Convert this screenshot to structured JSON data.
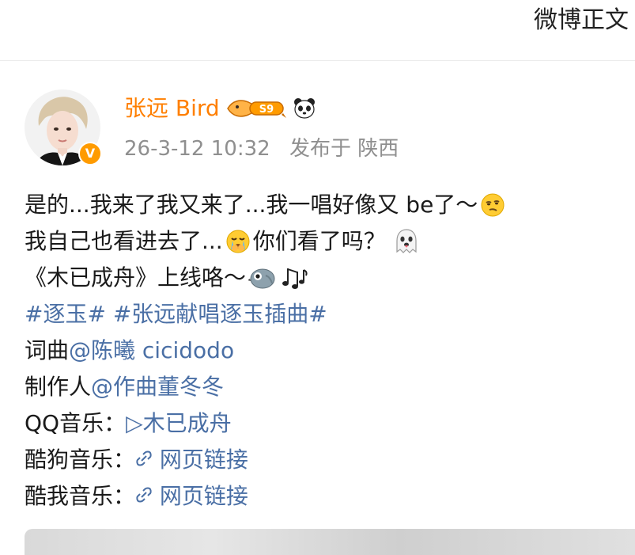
{
  "header": {
    "title": "微博正文"
  },
  "post": {
    "author": {
      "name": "张远 Bird",
      "level_badge": "S9",
      "verified_mark": "V",
      "icons": [
        "fish-level-badge-icon",
        "panda-icon",
        "verified-v-icon"
      ]
    },
    "time": "26-3-12 10:32",
    "location": "发布于 陕西",
    "lines": [
      {
        "text": "是的...我来了我又来了...我一唱好像又 be了～",
        "emoji": "thinking-face-icon"
      },
      {
        "text": "我自己也看进去了...",
        "emoji": "crying-face-icon",
        "text2": "你们看了吗？",
        "emoji2": "ghost-icon"
      },
      {
        "text": "《木已成舟》上线咯～",
        "emoji": "bird-icon",
        "emoji2": "music-notes-icon"
      }
    ],
    "topics": "#逐玉# #张远献唱逐玉插曲#",
    "credits": [
      {
        "label": "词曲 ",
        "value": "@陈曦 cicidodo"
      },
      {
        "label": "制作人 ",
        "value": "@作曲董冬冬"
      }
    ],
    "music_links": [
      {
        "label": "QQ音乐：",
        "value": "▷木已成舟",
        "icon": "play-icon"
      },
      {
        "label": "酷狗音乐：",
        "value": "网页链接",
        "icon": "link-icon"
      },
      {
        "label": "酷我音乐：",
        "value": "网页链接",
        "icon": "link-icon"
      }
    ]
  },
  "colors": {
    "username": "#ff7f00",
    "link": "#4a6fa5",
    "meta": "#8f8f8f",
    "verified": "#ff9b00"
  }
}
